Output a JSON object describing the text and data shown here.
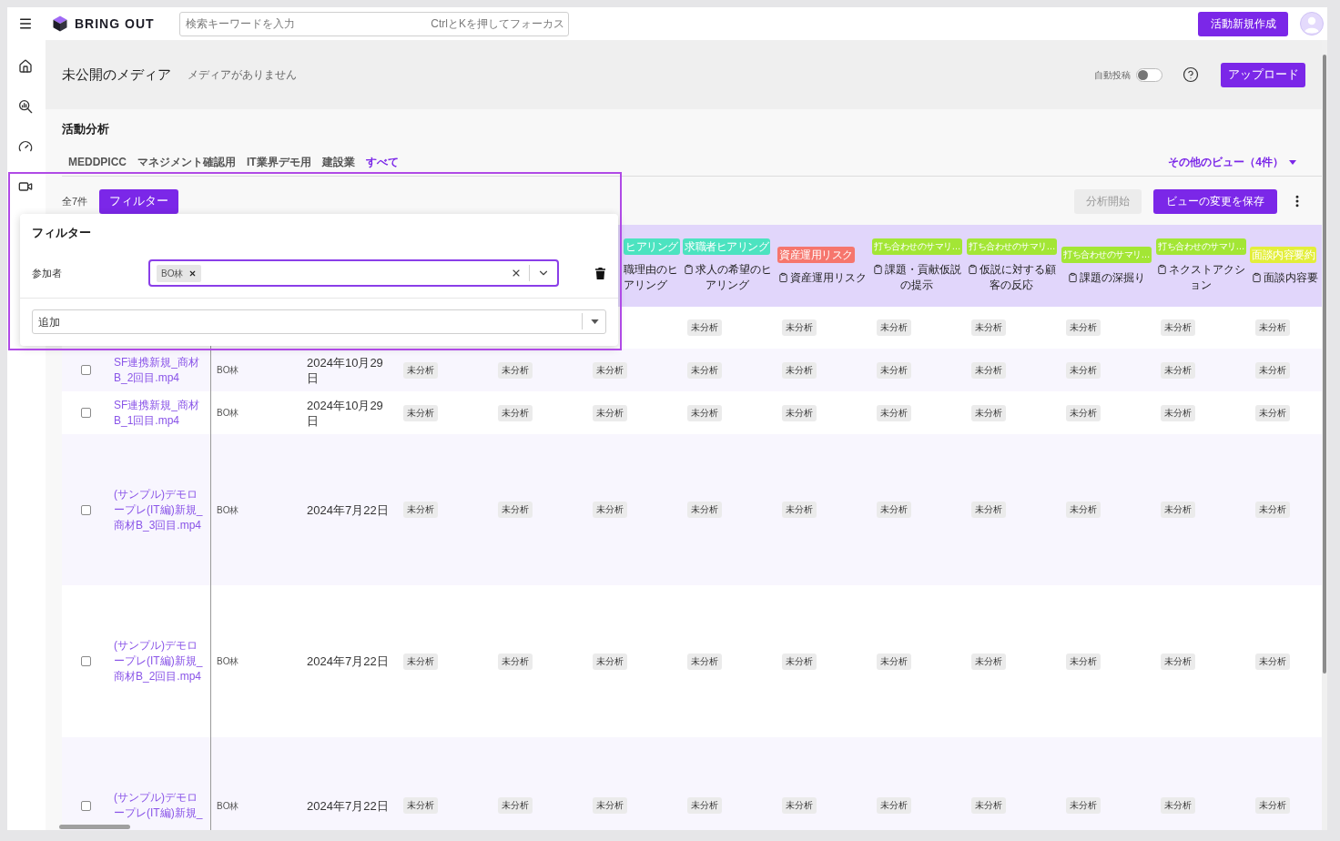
{
  "top_bar": {
    "brand": "BRING OUT",
    "search": {
      "placeholder": "検索キーワードを入力",
      "hint": "CtrlとKを押してフォーカス"
    },
    "create_button": "活動新規作成"
  },
  "media_header": {
    "title": "未公開のメディア",
    "subtitle": "メディアがありません",
    "auto_post": {
      "label": "自動投稿",
      "on": false
    },
    "upload_button": "アップロード"
  },
  "analysis": {
    "title": "活動分析",
    "tabs": [
      {
        "label": "MEDDPICC",
        "selected": false
      },
      {
        "label": "マネジメント確認用",
        "selected": false
      },
      {
        "label": "IT業界デモ用",
        "selected": false
      },
      {
        "label": "建設業",
        "selected": false
      },
      {
        "label": "すべて",
        "selected": true
      }
    ],
    "other_views": "その他のビュー（4件）",
    "count": "全7件",
    "filter_button": "フィルター",
    "start_button": {
      "label": "分析開始",
      "disabled": true
    },
    "save_button": "ビューの変更を保存"
  },
  "table": {
    "columns": [
      {
        "kind": "partial",
        "tag": "ヒアリング",
        "color": "#4ce3c0",
        "title": "職理由のヒアリング"
      },
      {
        "kind": "full",
        "tag": "求職者ヒアリング",
        "color": "#4ce3c0",
        "title": "求人の希望のヒアリング"
      },
      {
        "kind": "full",
        "tag": "資産運用リスク",
        "color": "#f6766d",
        "title": "資産運用リスク"
      },
      {
        "kind": "full",
        "tag": "打ち合わせのサマリ…",
        "color": "#a3e635",
        "title": "課題・貢献仮説の提示"
      },
      {
        "kind": "full",
        "tag": "打ち合わせのサマリ…",
        "color": "#a3e635",
        "title": "仮説に対する顧客の反応"
      },
      {
        "kind": "full",
        "tag": "打ち合わせのサマリ…",
        "color": "#a3e635",
        "title": "課題の深掘り"
      },
      {
        "kind": "full",
        "tag": "打ち合わせのサマリ…",
        "color": "#a3e635",
        "title": "ネクストアクション"
      },
      {
        "kind": "full",
        "tag": "面談内容要約",
        "color": "#e3ee3a",
        "title": "面談内容要"
      }
    ],
    "rows": [
      {
        "statuses": [
          "未分析",
          "未分析",
          "未分析",
          "未分析",
          "未分析",
          "未分析",
          "未分析"
        ]
      },
      {
        "checked": false,
        "file": "SF連携新規_商材B_2回目.mp4",
        "participant": "BO林",
        "date": "2024年10月29日",
        "statuses": [
          "未分析",
          "未分析",
          "未分析",
          "未分析",
          "未分析",
          "未分析",
          "未分析",
          "未分析",
          "未分析",
          "未分析"
        ]
      },
      {
        "checked": false,
        "file": "SF連携新規_商材B_1回目.mp4",
        "participant": "BO林",
        "date": "2024年10月29日",
        "statuses": [
          "未分析",
          "未分析",
          "未分析",
          "未分析",
          "未分析",
          "未分析",
          "未分析",
          "未分析",
          "未分析",
          "未分析"
        ]
      },
      {
        "checked": false,
        "file": "(サンプル)デモロープレ(IT編)新規_商材B_3回目.mp4",
        "participant": "BO林",
        "date": "2024年7月22日",
        "statuses": [
          "未分析",
          "未分析",
          "未分析",
          "未分析",
          "未分析",
          "未分析",
          "未分析",
          "未分析",
          "未分析",
          "未分析"
        ]
      },
      {
        "checked": false,
        "file": "(サンプル)デモロープレ(IT編)新規_商材B_2回目.mp4",
        "participant": "BO林",
        "date": "2024年7月22日",
        "statuses": [
          "未分析",
          "未分析",
          "未分析",
          "未分析",
          "未分析",
          "未分析",
          "未分析",
          "未分析",
          "未分析",
          "未分析"
        ]
      },
      {
        "checked": false,
        "file": "(サンプル)デモロープレ(IT編)新規_",
        "participant": "BO林",
        "date": "2024年7月22日",
        "statuses": [
          "未分析",
          "未分析",
          "未分析",
          "未分析",
          "未分析",
          "未分析",
          "未分析",
          "未分析",
          "未分析",
          "未分析"
        ]
      }
    ]
  },
  "filter_popup": {
    "title": "フィルター",
    "conditions": [
      {
        "label": "参加者",
        "chips": [
          "BO林"
        ]
      }
    ],
    "add_select": {
      "placeholder": "追加"
    }
  }
}
